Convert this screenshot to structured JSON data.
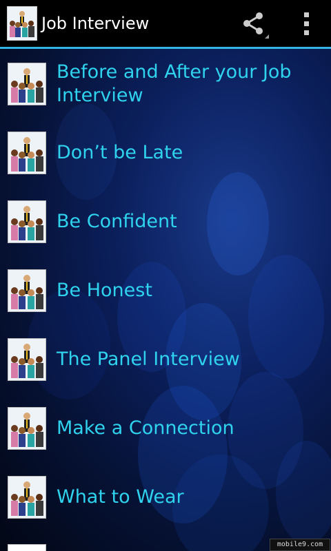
{
  "actionbar": {
    "title": "Job Interview",
    "app_icon": "job-interview-people-icon",
    "share_icon": "share-icon",
    "menu_icon": "overflow-menu-icon"
  },
  "list": {
    "items": [
      {
        "label": "Before and After your Job Interview",
        "icon": "job-interview-people-icon"
      },
      {
        "label": "Don’t be Late",
        "icon": "job-interview-people-icon"
      },
      {
        "label": "Be Confident",
        "icon": "job-interview-people-icon"
      },
      {
        "label": "Be Honest",
        "icon": "job-interview-people-icon"
      },
      {
        "label": "The Panel Interview",
        "icon": "job-interview-people-icon"
      },
      {
        "label": "Make a Connection",
        "icon": "job-interview-people-icon"
      },
      {
        "label": "What to Wear",
        "icon": "job-interview-people-icon"
      }
    ]
  },
  "watermark": {
    "text": "mobile9.com"
  },
  "colors": {
    "actionbar_bg": "#000000",
    "actionbar_line": "#33b5e5",
    "list_text": "#2fd3ee",
    "background": "#0b1f5c"
  }
}
